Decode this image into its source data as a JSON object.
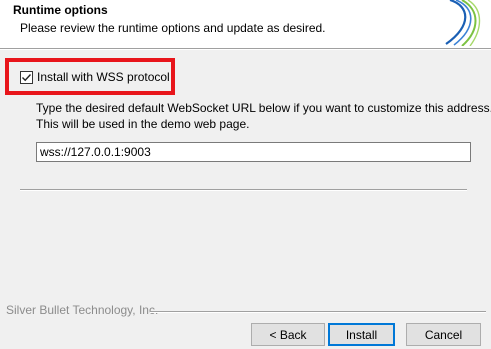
{
  "header": {
    "title": "Runtime options",
    "subtitle": "Please review the runtime options and update as desired."
  },
  "options": {
    "wss_checkbox_label": "Install with WSS protocol",
    "wss_checked": true,
    "description_line1": "Type the desired default WebSocket URL below if you want to customize this address.",
    "description_line2": "This will be used in the demo web page.",
    "url_value": "wss://127.0.0.1:9003"
  },
  "footer": {
    "branding": "Silver Bullet Technology, Inc.",
    "back_label": "< Back",
    "install_label": "Install",
    "cancel_label": "Cancel"
  },
  "colors": {
    "highlight_frame": "#e8151b",
    "default_button_border": "#0078d7",
    "logo_blue": "#1a5fb4",
    "logo_green": "#7cc242"
  }
}
